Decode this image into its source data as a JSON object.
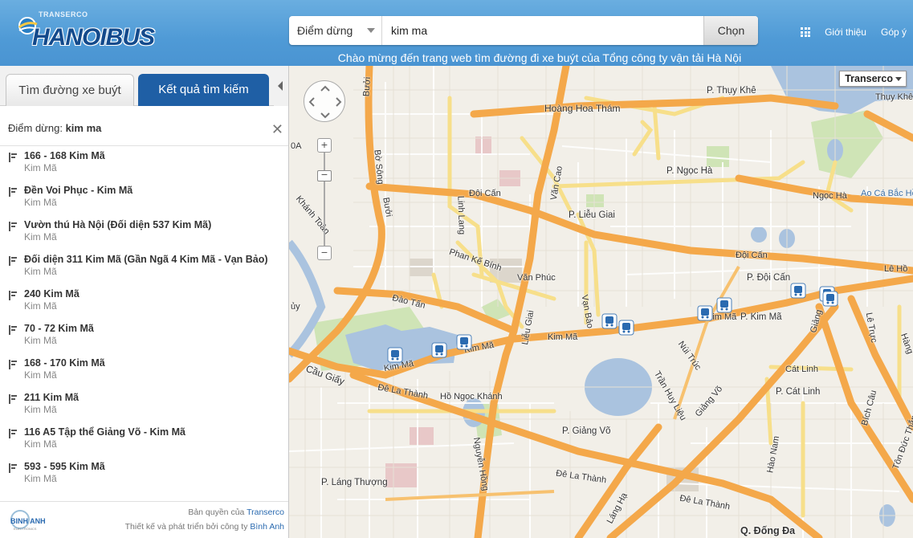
{
  "header": {
    "logo_tag": "TRANSERCO",
    "logo_text": "HANOIBUS",
    "search_type": "Điểm dừng",
    "search_value": "kim ma",
    "search_button": "Chọn",
    "welcome": "Chào mừng đến trang web tìm đường đi xe buýt của Tổng công ty vận tải Hà Nội",
    "nav": {
      "intro": "Giới thiệu",
      "feedback": "Góp ý"
    }
  },
  "sidebar": {
    "tabs": [
      {
        "label": "Tìm đường xe buýt"
      },
      {
        "label": "Kết quả tìm kiếm"
      }
    ],
    "query_label": "Điểm dừng:",
    "query_value": "kim ma",
    "results": [
      {
        "title": "166 - 168 Kim Mã",
        "street": "Kim Mã"
      },
      {
        "title": "Đền Voi Phục - Kim Mã",
        "street": "Kim Mã"
      },
      {
        "title": "Vườn thú Hà Nội (Đối diện 537 Kim Mã)",
        "street": "Kim Mã"
      },
      {
        "title": "Đối diện 311 Kim Mã (Gần Ngã 4 Kim Mã - Vạn Bảo)",
        "street": "Kim Mã"
      },
      {
        "title": "240 Kim Mã",
        "street": "Kim Mã"
      },
      {
        "title": "70 - 72 Kim Mã",
        "street": "Kim Mã"
      },
      {
        "title": "168 - 170 Kim Mã",
        "street": "Kim Mã"
      },
      {
        "title": "211 Kim Mã",
        "street": "Kim Mã"
      },
      {
        "title": "116 A5 Tập thể Giảng Võ - Kim Mã",
        "street": "Kim Mã"
      },
      {
        "title": "593 - 595 Kim Mã",
        "street": "Kim Mã"
      }
    ],
    "footer": {
      "brand": "BINH ANH",
      "copyright_prefix": "Bản quyền của",
      "copyright_owner": "Transerco",
      "design_prefix": "Thiết kế và phát triển bởi công ty",
      "design_owner": "Bình Anh"
    }
  },
  "map": {
    "type_selector": "Transerco",
    "labels": {
      "thuy_khe": "P. Thụy Khê",
      "thuy_khe_street": "Thụy Khê",
      "hoang_hoa_tham": "Hoàng Hoa Thám",
      "ngoc_ha": "P. Ngọc Hà",
      "ngoc_ha_street": "Ngọc Hà",
      "doi_can_street": "Đội Cấn",
      "doi_can_street2": "Đội Cấn",
      "p_doi_can": "P. Đội Cấn",
      "lieu_giai": "P. Liễu Giai",
      "van_cao": "Văn Cao",
      "buoi": "Bưởi",
      "buoi2": "Bưởi",
      "linh_lang": "Linh Lang",
      "phan_ke_binh": "Phan Kế Bính",
      "van_phuc": "Văn Phúc",
      "lieu_giai_street": "Liễu Giai",
      "dao_tan": "Đào Tấn",
      "kim_ma_1": "Kim Mã",
      "kim_ma_2": "Kim Mã",
      "kim_ma_3": "Kim Mã",
      "kim_ma_4": "Kim Mã",
      "p_kim_ma": "P. Kim Mã",
      "van_bao": "Vạn Bảo",
      "cau_giay": "Cầu Giấy",
      "de_la_thanh_1": "Đê La Thành",
      "de_la_thanh_2": "Đê La Thành",
      "de_la_thanh_3": "Đê La Thành",
      "ho_ngoc_khanh": "Hồ Ngọc Khánh",
      "giang_vo": "P. Giảng Võ",
      "giang_vo_street": "Giảng Võ",
      "cat_linh": "P. Cát Linh",
      "cat_linh_street": "Cát Linh",
      "nui_truc": "Núi Trúc",
      "tran_huy_lieu": "Trần Huy Liệu",
      "lang_thuong": "P. Láng Thượng",
      "nguyen_hong": "Nguyễn Hồng",
      "lang_ha": "Láng Hạ",
      "hao_nam": "Hào Nam",
      "dong_da": "Q. Đống Đa",
      "le_truc": "Lê Trực",
      "le_hong": "Lê Hồ",
      "bich_cau": "Bích Câu",
      "ton_duc_thang": "Tôn Đức Thắng",
      "giang": "Giảng",
      "ao_ca": "Ao Cá Bắc Hồ",
      "ha_ng": "Hàng",
      "row0a": "0A",
      "buoi_song": "Bờ Sông",
      "khanh_toan": "Khánh Toàn",
      "uy": "ủy"
    }
  }
}
